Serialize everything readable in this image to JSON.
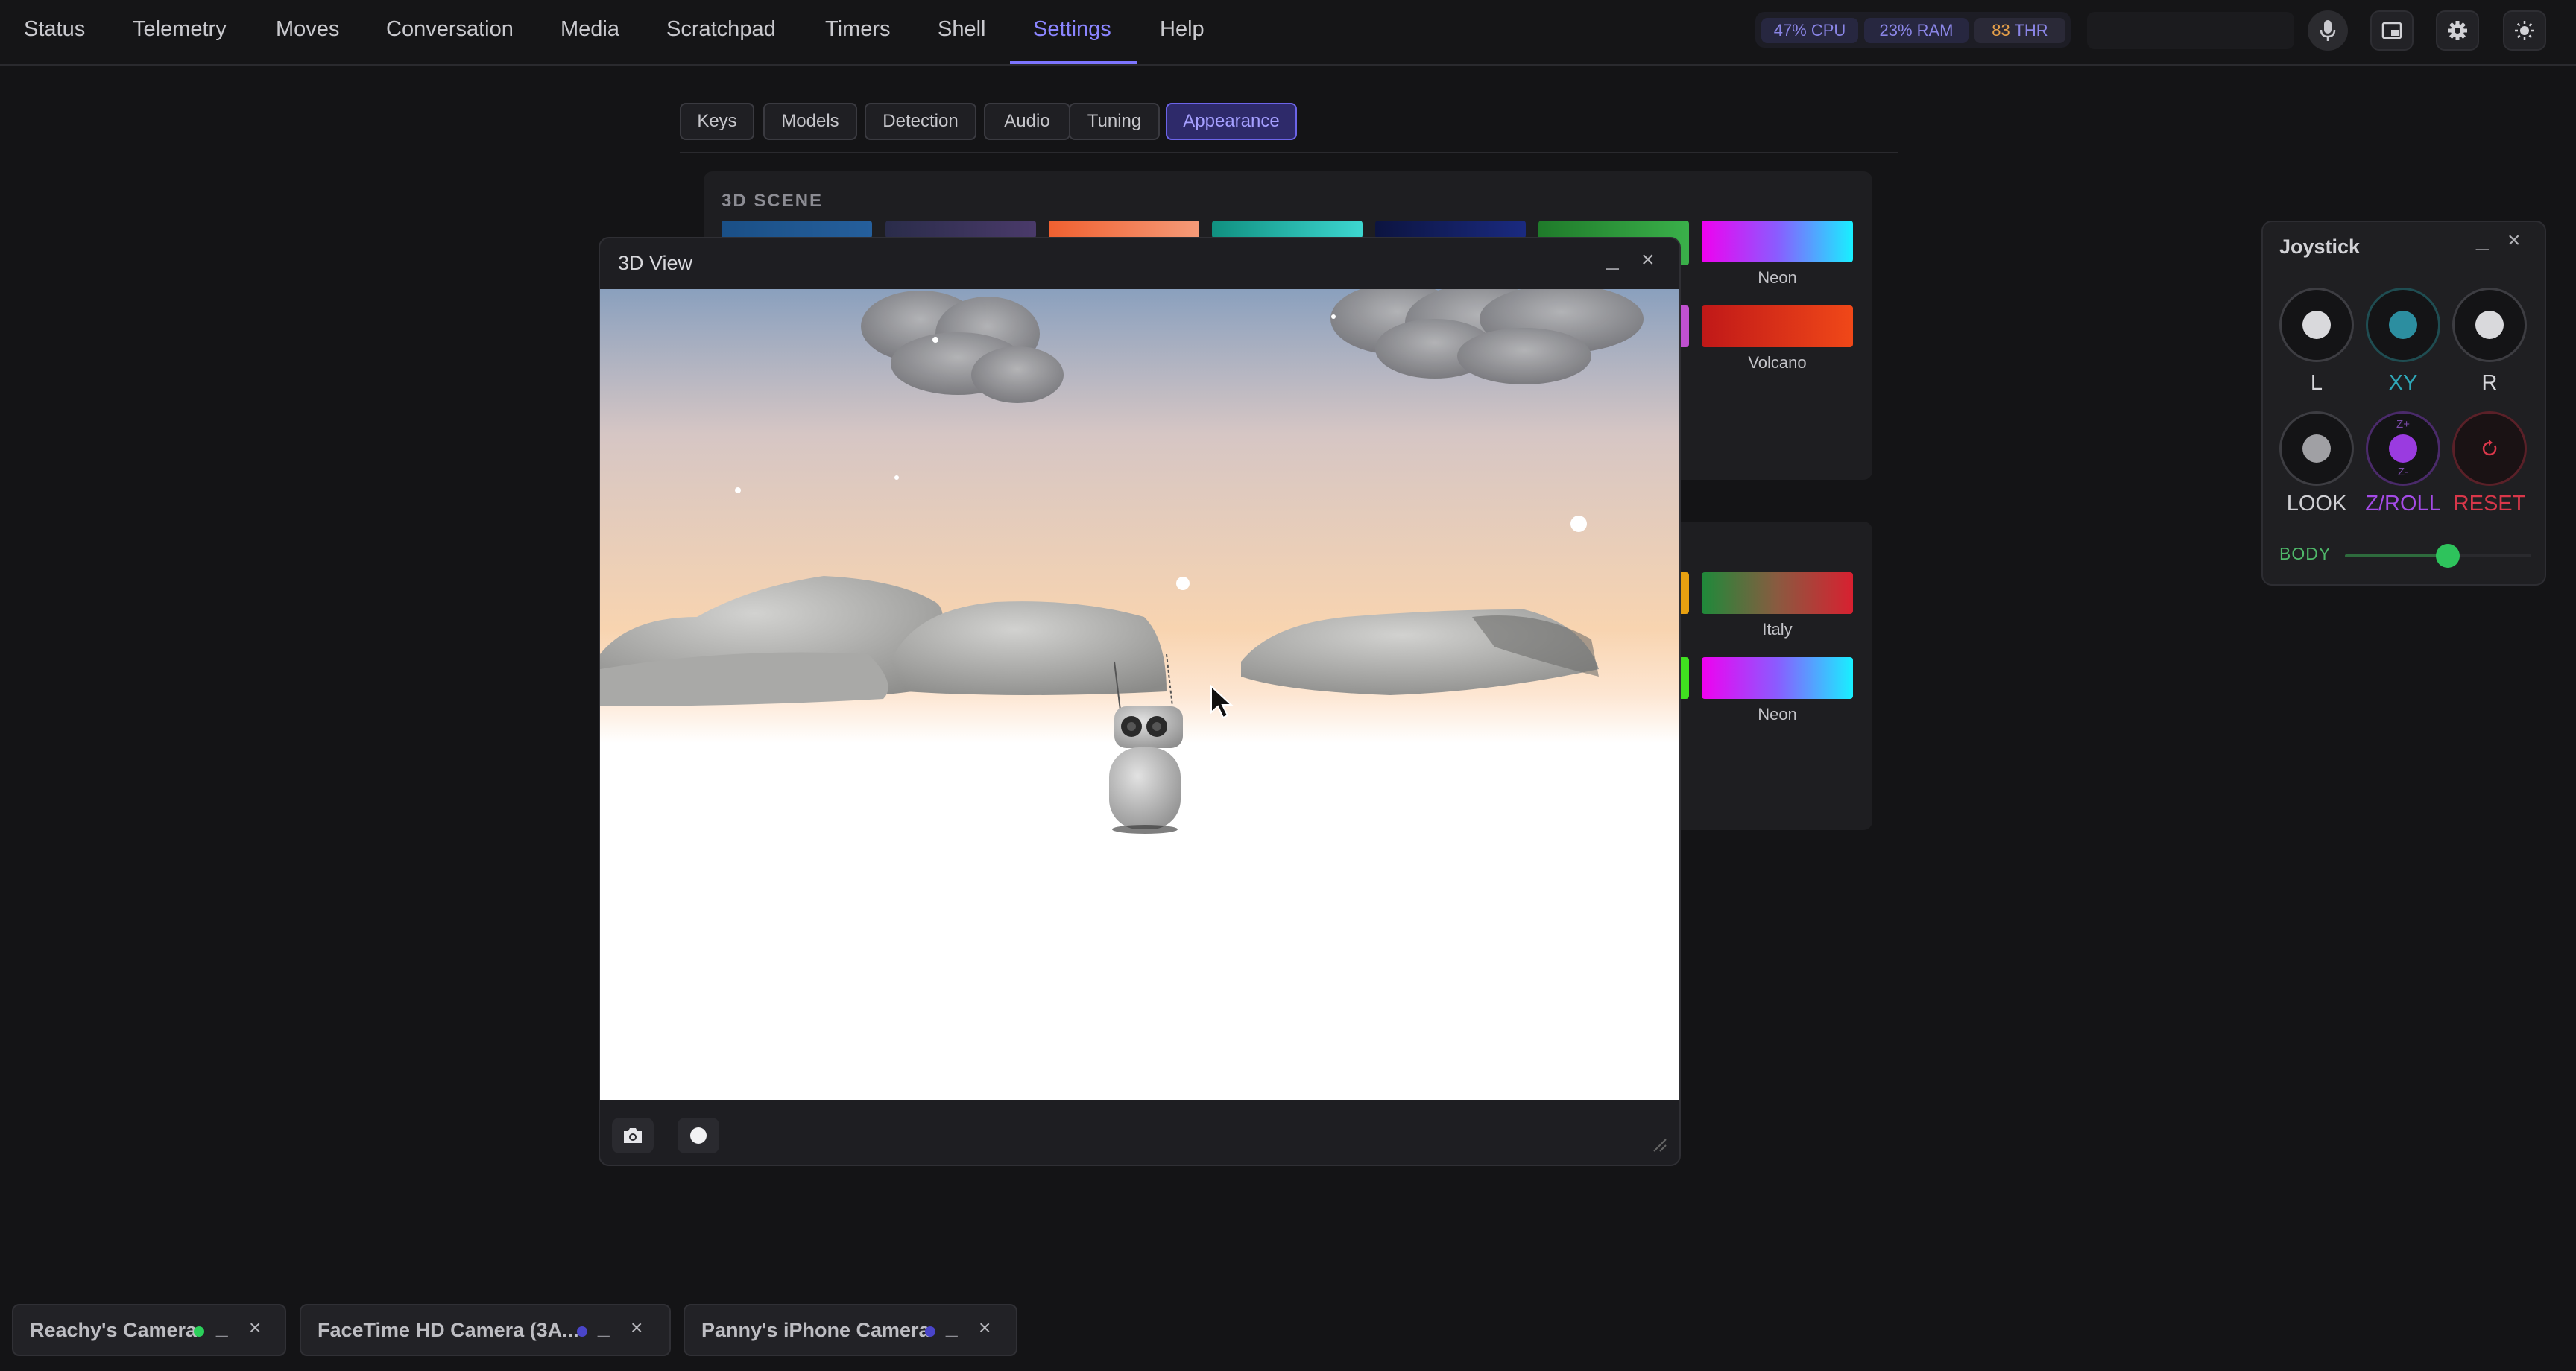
{
  "nav": {
    "items": [
      "Status",
      "Telemetry",
      "Moves",
      "Conversation",
      "Media",
      "Scratchpad",
      "Timers",
      "Shell",
      "Settings",
      "Help"
    ],
    "active": "Settings"
  },
  "stats": {
    "cpu": "47% CPU",
    "ram": "23% RAM",
    "thr_value": "83",
    "thr_label": "THR"
  },
  "settings_tabs": {
    "items": [
      "Keys",
      "Models",
      "Detection",
      "Audio",
      "Tuning",
      "Appearance"
    ],
    "active": "Appearance"
  },
  "scene_panel": {
    "title": "3D SCENE",
    "row1_label": "Neon",
    "row2_label": "Volcano"
  },
  "second_panel": {
    "row1_label": "Italy",
    "row2_label": "Neon"
  },
  "view3d": {
    "title": "3D View",
    "min_label": "_",
    "close_label": "×"
  },
  "joystick": {
    "title": "Joystick",
    "min_label": "_",
    "close_label": "×",
    "knobs": [
      "L",
      "XY",
      "R",
      "LOOK",
      "Z/ROLL",
      "RESET"
    ],
    "zroll_top": "Z+",
    "zroll_bottom": "Z-",
    "body_label": "BODY",
    "body_level": 0.55,
    "colors": {
      "l": "#d9d9dc",
      "xy": "#2c8ea0",
      "r": "#d9d9dc",
      "look": "#a0a0a4",
      "zroll": "#9a3be0",
      "reset": "#d9374a"
    }
  },
  "dock": {
    "items": [
      {
        "label": "Reachy's Camera",
        "status_color": "#2bd05a"
      },
      {
        "label": "FaceTime HD Camera (3A...",
        "status_color": "#4a45c9"
      },
      {
        "label": "Panny's iPhone Camera",
        "status_color": "#4a45c9"
      }
    ],
    "min_label": "_",
    "close_label": "×"
  }
}
